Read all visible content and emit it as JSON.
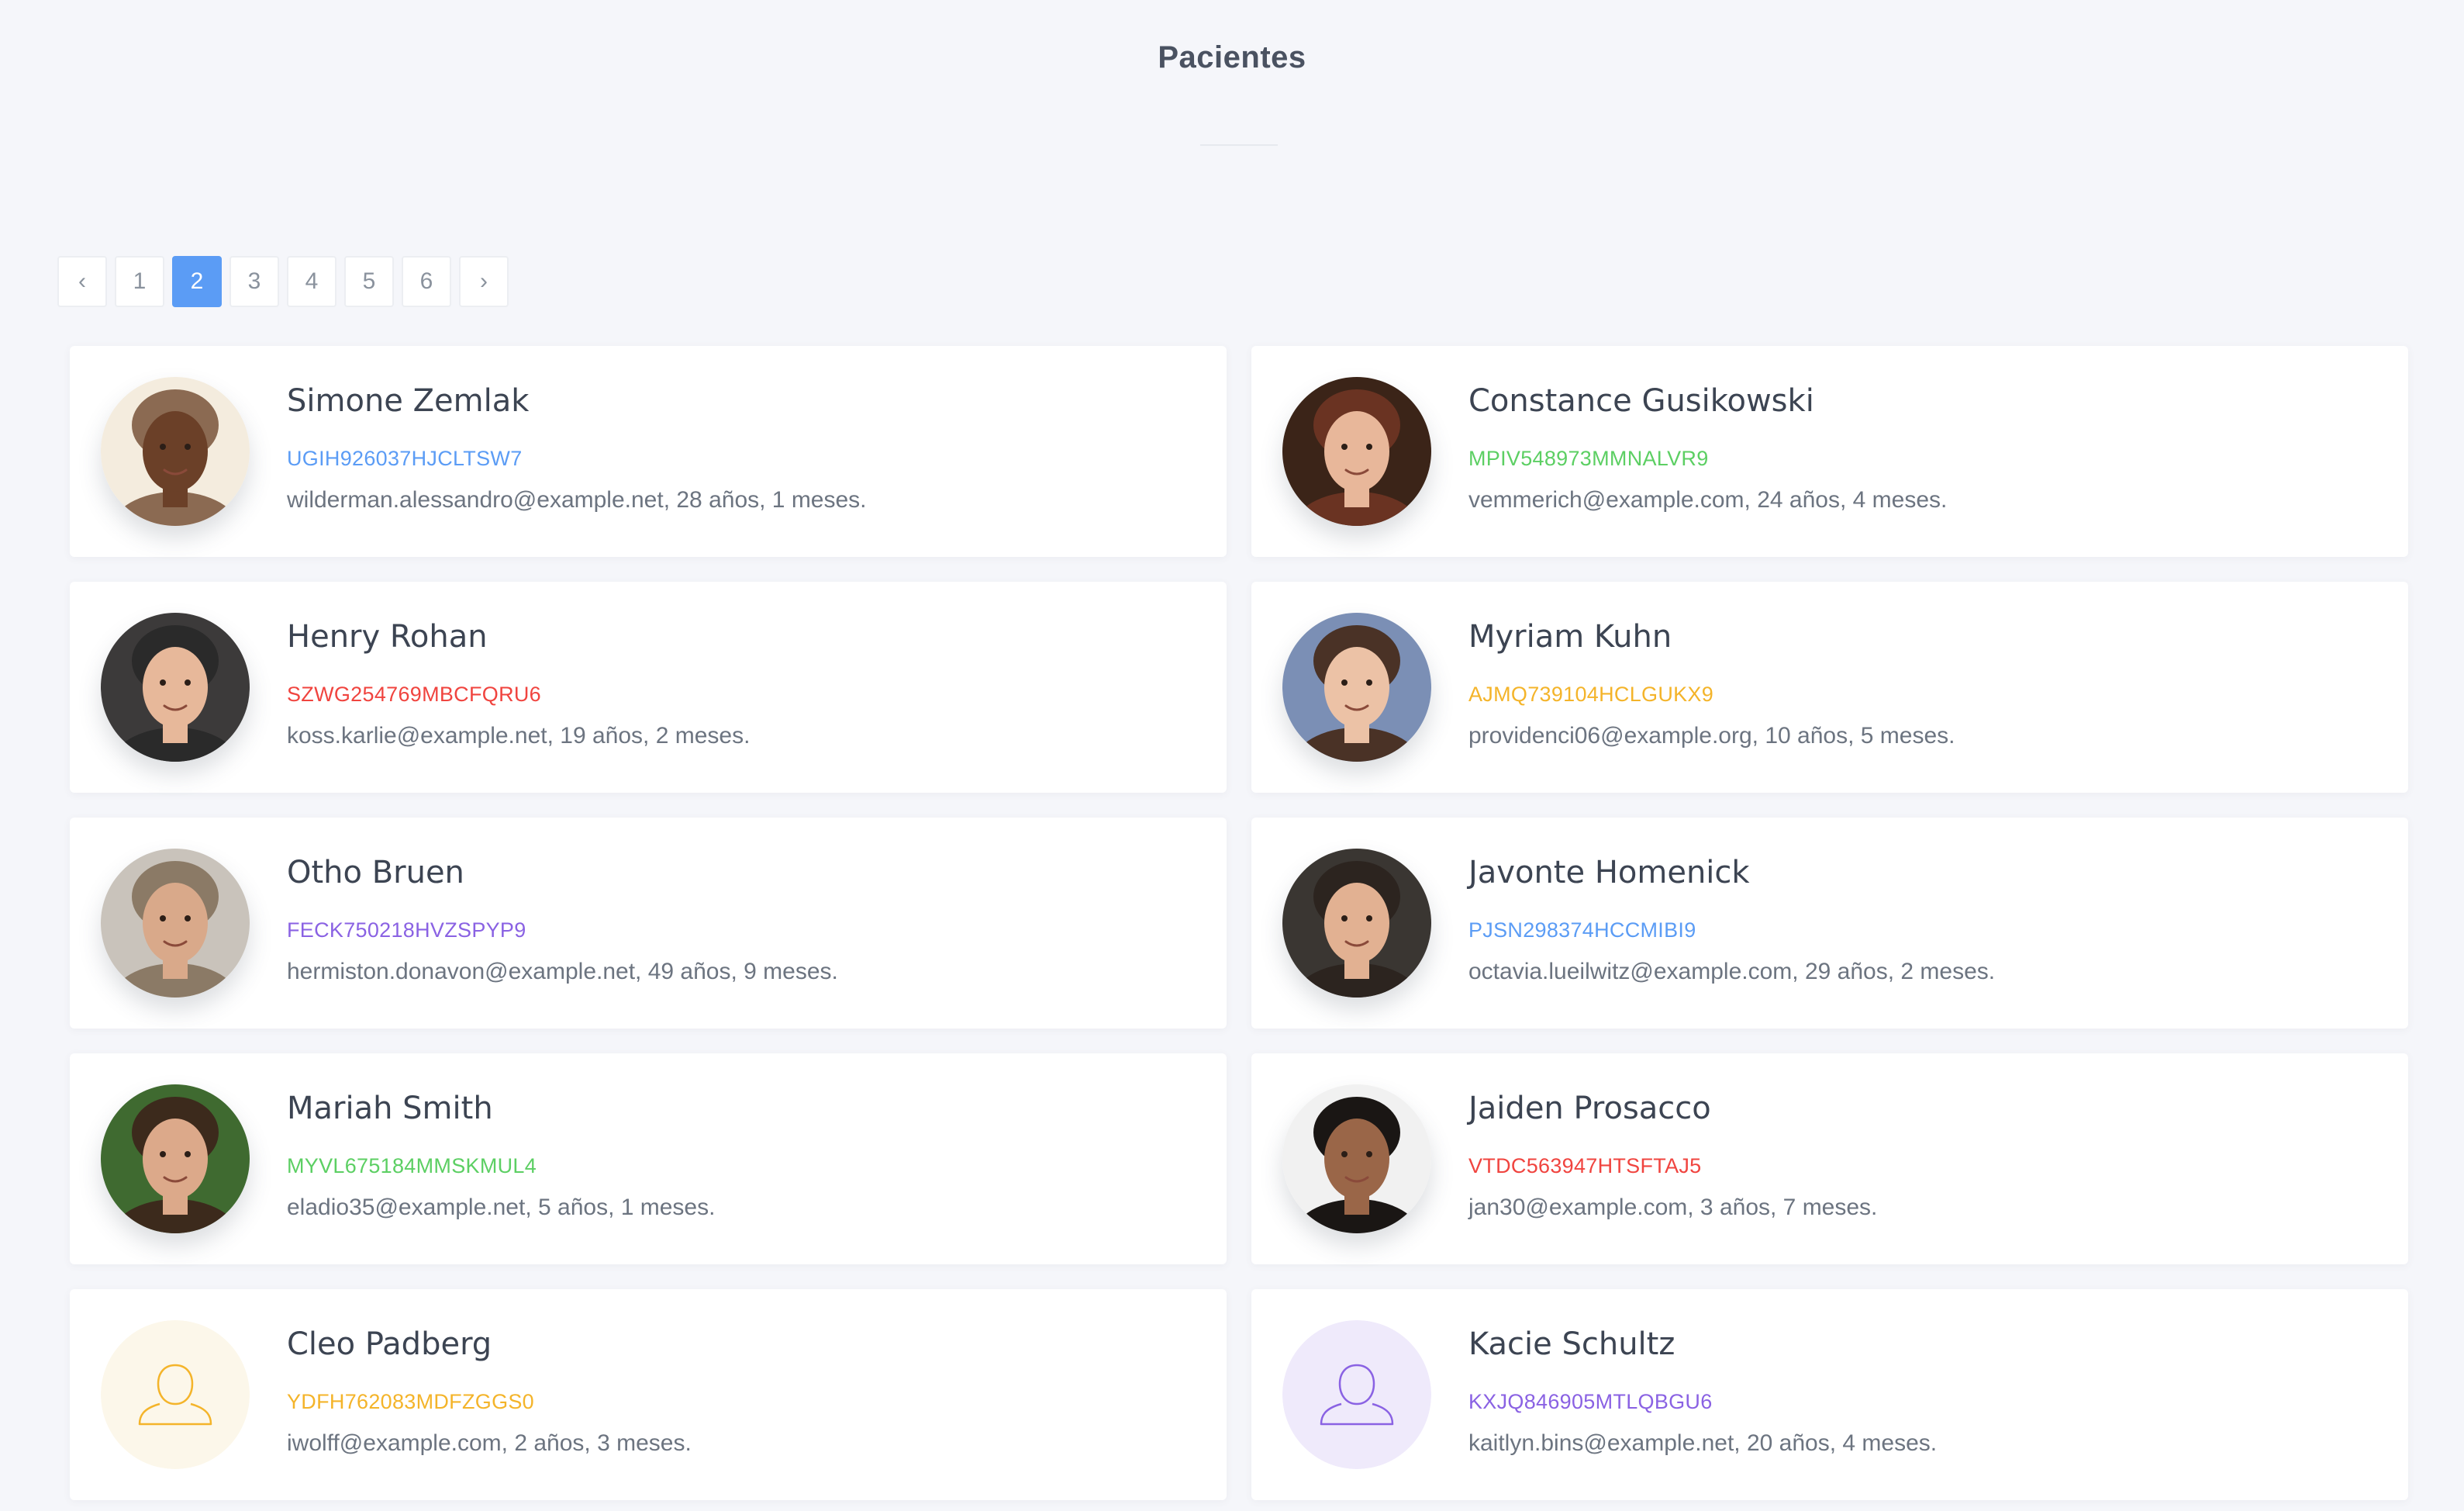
{
  "page": {
    "title": "Pacientes"
  },
  "pagination": {
    "prev_label": "‹",
    "next_label": "›",
    "pages": [
      "1",
      "2",
      "3",
      "4",
      "5",
      "6"
    ],
    "current": "2"
  },
  "patients": [
    {
      "name": "Simone Zemlak",
      "code": "UGIH926037HJCLTSW7",
      "code_color": "#5b9cf5",
      "info": "wilderman.alessandro@example.net, 28 años, 1 meses.",
      "avatar": {
        "type": "photo",
        "skin": "#6b4028",
        "hair": "#8b6a52",
        "bg": "#f4ecde"
      }
    },
    {
      "name": "Constance Gusikowski",
      "code": "MPIV548973MMNALVR9",
      "code_color": "#5ccf63",
      "info": "vemmerich@example.com, 24 años, 4 meses.",
      "avatar": {
        "type": "photo",
        "skin": "#e8b79a",
        "hair": "#6a3322",
        "bg": "#3b2418"
      }
    },
    {
      "name": "Henry Rohan",
      "code": "SZWG254769MBCFQRU6",
      "code_color": "#f0443f",
      "info": "koss.karlie@example.net, 19 años, 2 meses.",
      "avatar": {
        "type": "photo",
        "skin": "#e7b89a",
        "hair": "#2a2a2a",
        "bg": "#3c3a3a"
      }
    },
    {
      "name": "Myriam Kuhn",
      "code": "AJMQ739104HCLGUKX9",
      "code_color": "#f4b42a",
      "info": "providenci06@example.org, 10 años, 5 meses.",
      "avatar": {
        "type": "photo",
        "skin": "#ecc2a6",
        "hair": "#4a3226",
        "bg": "#7b8fb5"
      }
    },
    {
      "name": "Otho Bruen",
      "code": "FECK750218HVZSPYP9",
      "code_color": "#8a62e3",
      "info": "hermiston.donavon@example.net, 49 años, 9 meses.",
      "avatar": {
        "type": "photo",
        "skin": "#d9a98a",
        "hair": "#8b7a66",
        "bg": "#c9c3bb"
      }
    },
    {
      "name": "Javonte Homenick",
      "code": "PJSN298374HCCMIBI9",
      "code_color": "#5b9cf5",
      "info": "octavia.lueilwitz@example.com, 29 años, 2 meses.",
      "avatar": {
        "type": "photo",
        "skin": "#e2b192",
        "hair": "#2c241f",
        "bg": "#3a3632"
      }
    },
    {
      "name": "Mariah Smith",
      "code": "MYVL675184MMSKMUL4",
      "code_color": "#5ccf63",
      "info": "eladio35@example.net, 5 años, 1 meses.",
      "avatar": {
        "type": "photo",
        "skin": "#dca98a",
        "hair": "#3c2a1c",
        "bg": "#3f6a30"
      }
    },
    {
      "name": "Jaiden Prosacco",
      "code": "VTDC563947HTSFTAJ5",
      "code_color": "#f0443f",
      "info": "jan30@example.com, 3 años, 7 meses.",
      "avatar": {
        "type": "photo",
        "skin": "#9a6648",
        "hair": "#1a1614",
        "bg": "#f1f1f1"
      }
    },
    {
      "name": "Cleo Padberg",
      "code": "YDFH762083MDFZGGS0",
      "code_color": "#f4b42a",
      "info": "iwolff@example.com, 2 años, 3 meses.",
      "avatar": {
        "type": "placeholder",
        "bg": "#fcf7ea",
        "stroke": "#f4b42a"
      }
    },
    {
      "name": "Kacie Schultz",
      "code": "KXJQ846905MTLQBGU6",
      "code_color": "#8a62e3",
      "info": "kaitlyn.bins@example.net, 20 años, 4 meses.",
      "avatar": {
        "type": "placeholder",
        "bg": "#efeafb",
        "stroke": "#8a62e3"
      }
    }
  ]
}
